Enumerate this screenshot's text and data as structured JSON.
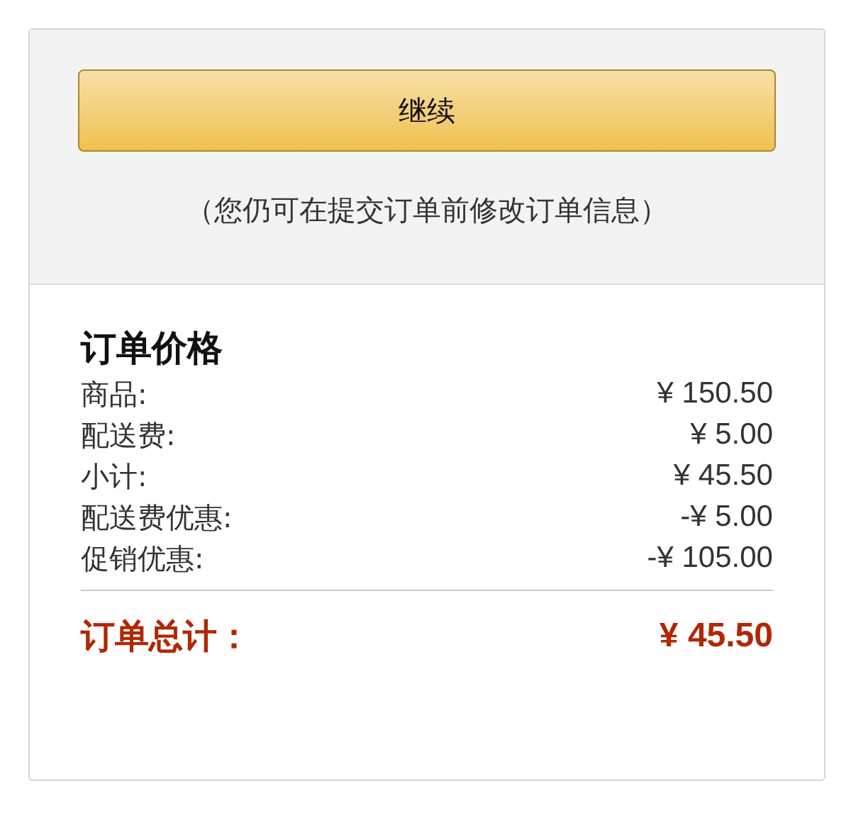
{
  "continue_button": {
    "label": "继续"
  },
  "note": "（您仍可在提交订单前修改订单信息）",
  "summary": {
    "title": "订单价格",
    "rows": [
      {
        "label": "商品:",
        "amount": "¥ 150.50"
      },
      {
        "label": "配送费:",
        "amount": "¥ 5.00"
      },
      {
        "label": "小计:",
        "amount": "¥ 45.50"
      },
      {
        "label": "配送费优惠:",
        "amount": "-¥ 5.00"
      },
      {
        "label": "促销优惠:",
        "amount": "-¥ 105.00"
      }
    ],
    "total": {
      "label": "订单总计：",
      "amount": "¥ 45.50"
    }
  }
}
